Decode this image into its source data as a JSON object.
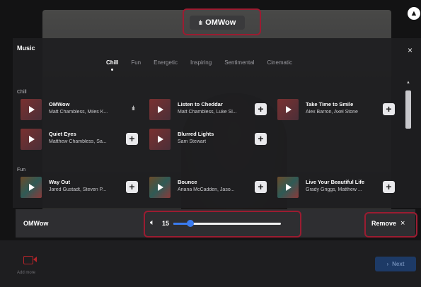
{
  "top_track": {
    "title": "OMWow",
    "icon": "audio-wave-icon"
  },
  "panel": {
    "title": "Music",
    "tabs": [
      "Chill",
      "Fun",
      "Energetic",
      "Inspiring",
      "Sentimental",
      "Cinematic"
    ],
    "active_tab": "Chill",
    "sections": [
      {
        "label": "Chill",
        "tracks": [
          {
            "title": "OMWow",
            "artist": "Matt Chambless, Miles K...",
            "state": "playing"
          },
          {
            "title": "Listen to Cheddar",
            "artist": "Matt Chambless, Luke Sl...",
            "state": "add"
          },
          {
            "title": "Take Time to Smile",
            "artist": "Alex Barron, Axel Stone",
            "state": "add"
          },
          {
            "title": "Quiet Eyes",
            "artist": "Matthew Chambless, Sa...",
            "state": "add"
          },
          {
            "title": "Blurred Lights",
            "artist": "Sam Stewart",
            "state": "add"
          }
        ]
      },
      {
        "label": "Fun",
        "tracks": [
          {
            "title": "Way Out",
            "artist": "Jared Gustadt, Steven P...",
            "state": "add"
          },
          {
            "title": "Bounce",
            "artist": "Ariana McCadden, Jaso...",
            "state": "add"
          },
          {
            "title": "Live Your Beautiful Life",
            "artist": "Grady Griggs, Matthew ...",
            "state": "add"
          }
        ]
      }
    ],
    "add_symbol": "+",
    "close_symbol": "×"
  },
  "player": {
    "track_title": "OMWow",
    "volume_value": "15",
    "volume_fraction": 0.16,
    "remove_label": "Remove",
    "remove_symbol": "×"
  },
  "footer": {
    "add_more_label": "Add more",
    "next_label": "Next",
    "next_symbol": "›"
  },
  "colors": {
    "accent": "#3a7bf0",
    "highlight": "#9b1c31",
    "panel": "#1e1e21"
  }
}
